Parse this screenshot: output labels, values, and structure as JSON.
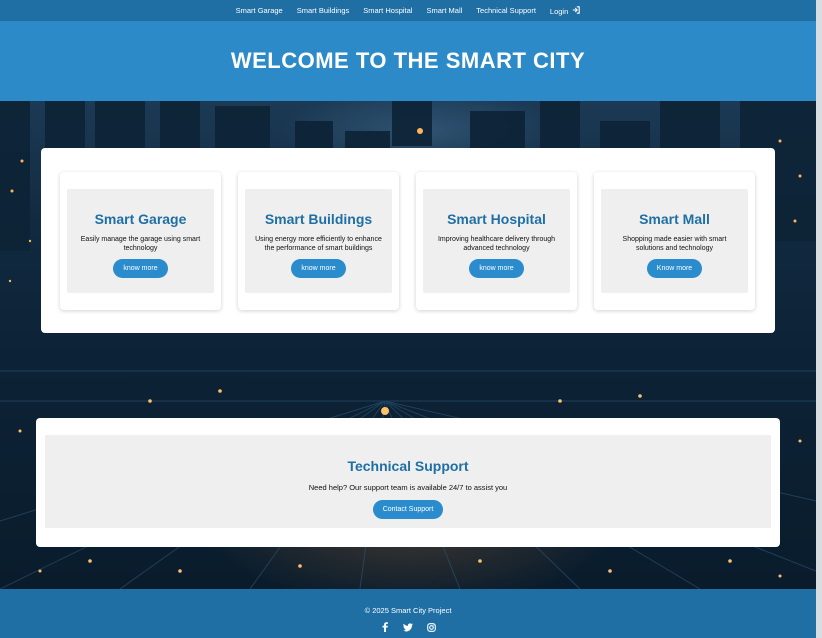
{
  "nav": {
    "items": [
      {
        "label": "Smart Garage"
      },
      {
        "label": "Smart Buildings"
      },
      {
        "label": "Smart Hospital"
      },
      {
        "label": "Smart Mall"
      },
      {
        "label": "Technical Support"
      },
      {
        "label": "Login"
      }
    ],
    "login_icon": "sign-in-icon"
  },
  "hero": {
    "title": "WELCOME TO THE SMART CITY"
  },
  "services": [
    {
      "title": "Smart Garage",
      "description": "Easily manage the garage using smart technology",
      "button": "know more"
    },
    {
      "title": "Smart Buildings",
      "description": "Using energy more efficiently to enhance the performance of smart buildings",
      "button": "know more"
    },
    {
      "title": "Smart Hospital",
      "description": "Improving healthcare delivery through advanced technology",
      "button": "know more"
    },
    {
      "title": "Smart Mall",
      "description": "Shopping made easier with smart solutions and technology",
      "button": "Know more"
    }
  ],
  "support": {
    "title": "Technical Support",
    "text": "Need help? Our support team is available 24/7 to assist you",
    "button": "Contact Support"
  },
  "footer": {
    "copyright": "© 2025 Smart City Project",
    "socials": [
      "facebook-icon",
      "twitter-icon",
      "instagram-icon"
    ]
  },
  "colors": {
    "nav_bg": "#1f6fa5",
    "hero_bg": "#2c8ac8",
    "accent": "#2a8ccc",
    "title_blue": "#1f6fa5",
    "card_inner": "#efefef"
  }
}
